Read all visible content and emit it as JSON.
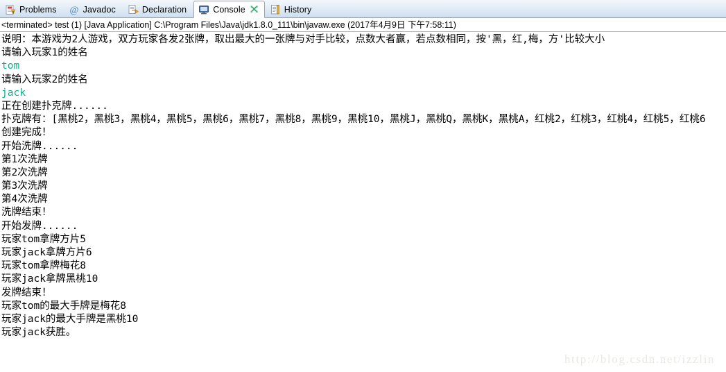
{
  "tabs": [
    {
      "label": "Problems",
      "icon": "problems-warning-icon",
      "active": false,
      "closable": false
    },
    {
      "label": "Javadoc",
      "icon": "javadoc-at-icon",
      "active": false,
      "closable": false
    },
    {
      "label": "Declaration",
      "icon": "declaration-icon",
      "active": false,
      "closable": false
    },
    {
      "label": "Console",
      "icon": "console-monitor-icon",
      "active": true,
      "closable": true,
      "close_icon": "close-x-icon"
    },
    {
      "label": "History",
      "icon": "history-document-icon",
      "active": false,
      "closable": false
    }
  ],
  "process": {
    "text": "<terminated> test (1) [Java Application] C:\\Program Files\\Java\\jdk1.8.0_111\\bin\\javaw.exe (2017年4月9日 下午7:58:11)"
  },
  "console": {
    "lines": [
      {
        "text": "说明：本游戏为2人游戏，双方玩家各发2张牌，取出最大的一张牌与对手比较，点数大者赢，若点数相同，按'黑，红,梅，方'比较大小",
        "type": "output"
      },
      {
        "text": "请输入玩家1的姓名",
        "type": "output"
      },
      {
        "text": "tom",
        "type": "input"
      },
      {
        "text": "请输入玩家2的姓名",
        "type": "output"
      },
      {
        "text": "jack",
        "type": "input"
      },
      {
        "text": "正在创建扑克牌......",
        "type": "output"
      },
      {
        "text": "扑克牌有：[黑桃2，黑桃3，黑桃4，黑桃5，黑桃6，黑桃7，黑桃8，黑桃9，黑桃10，黑桃J，黑桃Q，黑桃K，黑桃A，红桃2，红桃3，红桃4，红桃5，红桃6",
        "type": "output"
      },
      {
        "text": "创建完成！",
        "type": "output"
      },
      {
        "text": "开始洗牌......",
        "type": "output"
      },
      {
        "text": "第1次洗牌",
        "type": "output"
      },
      {
        "text": "第2次洗牌",
        "type": "output"
      },
      {
        "text": "第3次洗牌",
        "type": "output"
      },
      {
        "text": "第4次洗牌",
        "type": "output"
      },
      {
        "text": "洗牌结束！",
        "type": "output"
      },
      {
        "text": "开始发牌......",
        "type": "output"
      },
      {
        "text": "玩家tom拿牌方片5",
        "type": "output"
      },
      {
        "text": "玩家jack拿牌方片6",
        "type": "output"
      },
      {
        "text": "玩家tom拿牌梅花8",
        "type": "output"
      },
      {
        "text": "玩家jack拿牌黑桃10",
        "type": "output"
      },
      {
        "text": "发牌结束！",
        "type": "output"
      },
      {
        "text": "玩家tom的最大手牌是梅花8",
        "type": "output"
      },
      {
        "text": "玩家jack的最大手牌是黑桃10",
        "type": "output"
      },
      {
        "text": "玩家jack获胜。",
        "type": "output"
      }
    ],
    "input_color": "#0fae8c",
    "output_color": "#000000"
  },
  "watermark": {
    "text": "http://blog.csdn.net/izzlin"
  }
}
